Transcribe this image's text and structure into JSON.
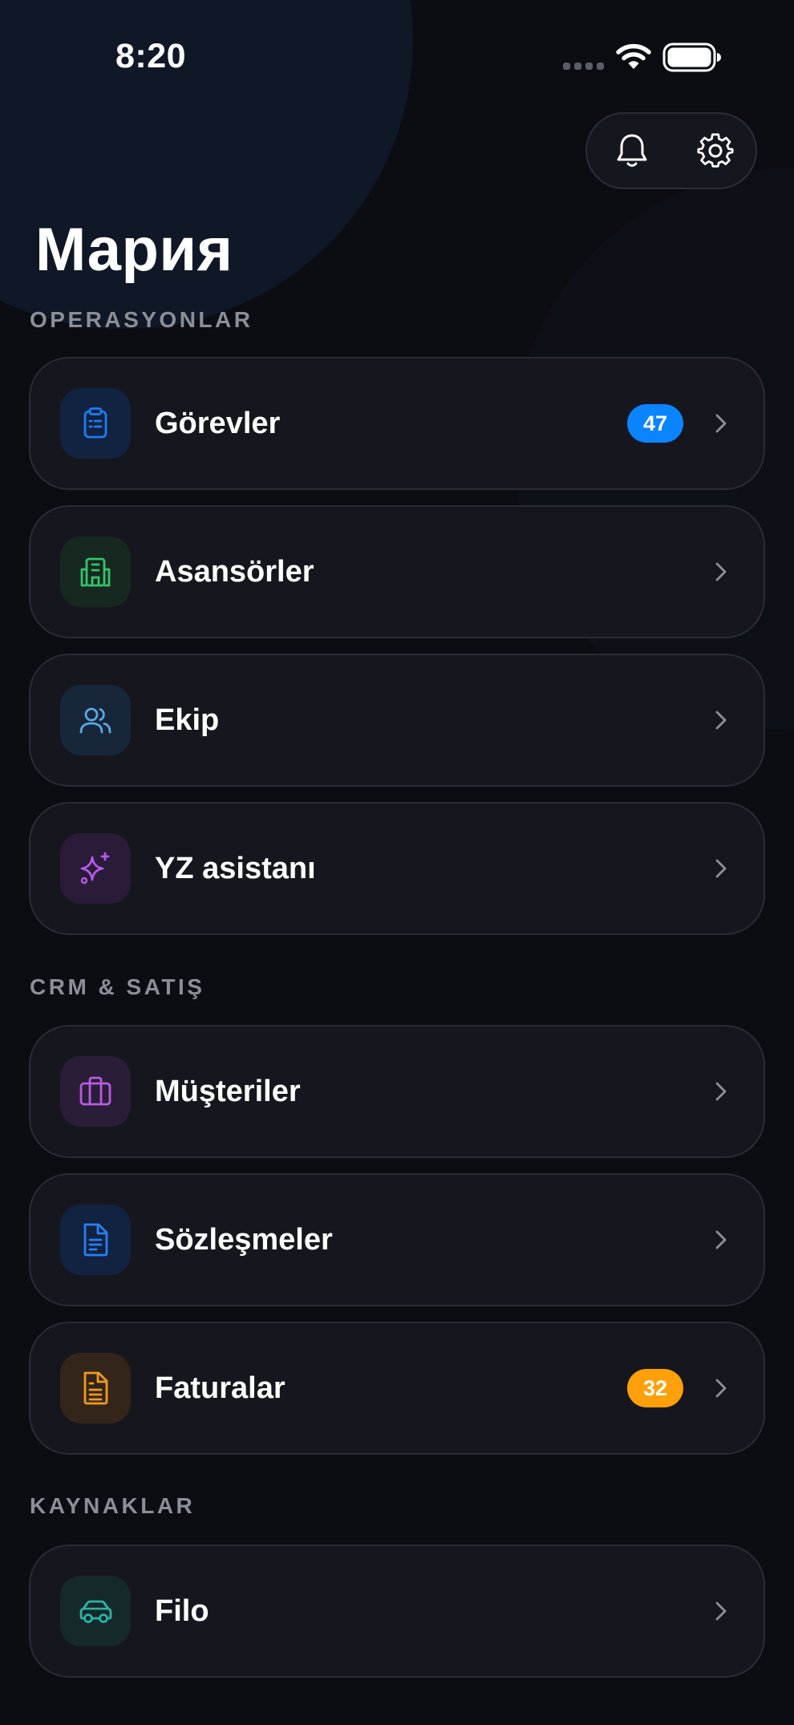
{
  "status_bar": {
    "time": "8:20"
  },
  "header": {
    "title": "Мария",
    "actions": [
      {
        "name": "notifications",
        "icon": "bell-icon"
      },
      {
        "name": "settings",
        "icon": "gear-icon"
      }
    ]
  },
  "sections": {
    "operations": {
      "label": "OPERASYONLAR",
      "items": [
        {
          "label": "Görevler",
          "icon": "clipboard-icon",
          "color": "#1f7cf0",
          "badge": "47",
          "badge_color": "#0a84ff"
        },
        {
          "label": "Asansörler",
          "icon": "building-icon",
          "color": "#34c36b"
        },
        {
          "label": "Ekip",
          "icon": "users-icon",
          "color": "#5aa8e6"
        },
        {
          "label": "YZ asistanı",
          "icon": "sparkles-icon",
          "color": "#b359e8"
        }
      ]
    },
    "crm": {
      "label": "CRM & SATIŞ",
      "items": [
        {
          "label": "Müşteriler",
          "icon": "briefcase-icon",
          "color": "#b65ce0"
        },
        {
          "label": "Sözleşmeler",
          "icon": "document-icon",
          "color": "#2a7ff0"
        },
        {
          "label": "Faturalar",
          "icon": "invoice-icon",
          "color": "#f09a1e",
          "badge": "32",
          "badge_color": "#ff9f0a"
        }
      ]
    },
    "resources": {
      "label": "KAYNAKLAR",
      "items": [
        {
          "label": "Filo",
          "icon": "car-icon",
          "color": "#2bb3a8"
        }
      ]
    }
  }
}
